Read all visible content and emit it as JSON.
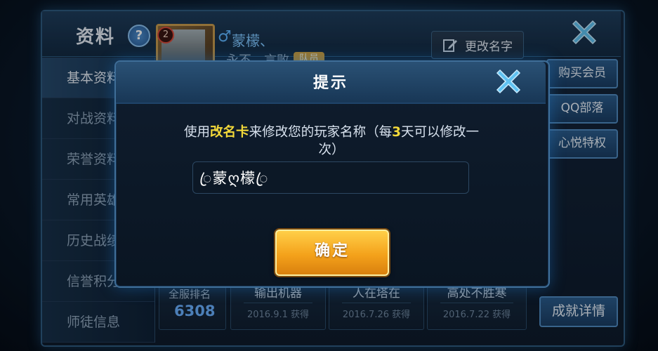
{
  "background_panel": {
    "title": "资料",
    "help_symbol": "?",
    "level_badge": "2",
    "gender_symbol": "♂",
    "player_name": "蒙檬、",
    "player_sign": "永不、言败",
    "team_badge": "队员",
    "rename_label": "更改名字"
  },
  "sidebar": {
    "items": [
      {
        "label": "基本资料"
      },
      {
        "label": "对战资料"
      },
      {
        "label": "荣誉资料"
      },
      {
        "label": "常用英雄"
      },
      {
        "label": "历史战绩"
      },
      {
        "label": "信誉积分"
      },
      {
        "label": "师徒信息"
      }
    ]
  },
  "right_buttons": {
    "buy_member": "购买会员",
    "qq_tribe": "QQ部落",
    "xinyue": "心悦特权",
    "achievement": "成就详情"
  },
  "stats": {
    "rank_label": "全服排名",
    "rank_value": "6308",
    "achievements": [
      {
        "title": "输出机器",
        "date": "2016.9.1 获得"
      },
      {
        "title": "人在塔在",
        "date": "2016.7.26 获得"
      },
      {
        "title": "高处不胜寒",
        "date": "2016.7.22 获得"
      }
    ]
  },
  "dialog": {
    "title": "提示",
    "message_part1": "使用",
    "message_highlight1": "改名卡",
    "message_part2": "来修改您的玩家名称（每",
    "message_highlight2": "3",
    "message_part3": "天可以修改一次）",
    "input_value": "ꦿ蒙ღ檬ꦿ",
    "confirm_label": "确定"
  },
  "colors": {
    "accent_blue": "#4f8ac0",
    "highlight_yellow": "#f3d93a",
    "confirm_orange": "#f4a21b"
  },
  "icons": {
    "help": "question-mark-icon",
    "close": "close-x-icon",
    "edit": "pencil-edit-icon",
    "gender": "male-symbol-icon"
  }
}
